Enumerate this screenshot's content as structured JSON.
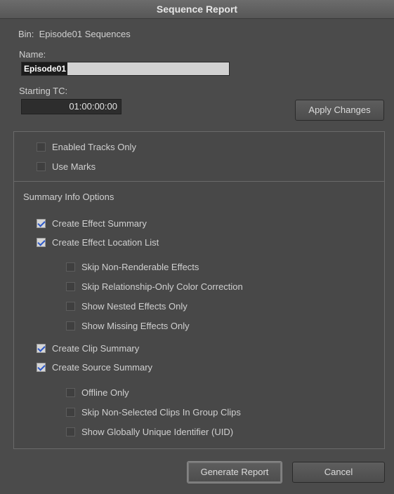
{
  "window": {
    "title": "Sequence Report"
  },
  "bin": {
    "label": "Bin:",
    "value": "Episode01 Sequences"
  },
  "name": {
    "label": "Name:",
    "value": "Episode01"
  },
  "starting_tc": {
    "label": "Starting TC:",
    "value": "01:00:00:00"
  },
  "buttons": {
    "apply": "Apply Changes",
    "generate": "Generate Report",
    "cancel": "Cancel"
  },
  "options": {
    "enabled_tracks_only": {
      "label": "Enabled Tracks Only",
      "checked": false
    },
    "use_marks": {
      "label": "Use Marks",
      "checked": false
    }
  },
  "summary": {
    "header": "Summary Info Options",
    "create_effect_summary": {
      "label": "Create Effect Summary",
      "checked": true
    },
    "create_effect_location_list": {
      "label": "Create Effect Location List",
      "checked": true
    },
    "skip_non_renderable": {
      "label": "Skip Non-Renderable Effects",
      "checked": false
    },
    "skip_relationship_only": {
      "label": "Skip Relationship-Only Color Correction",
      "checked": false
    },
    "show_nested_effects_only": {
      "label": "Show Nested Effects Only",
      "checked": false
    },
    "show_missing_effects_only": {
      "label": "Show Missing Effects Only",
      "checked": false
    },
    "create_clip_summary": {
      "label": "Create Clip Summary",
      "checked": true
    },
    "create_source_summary": {
      "label": "Create Source Summary",
      "checked": true
    },
    "offline_only": {
      "label": "Offline Only",
      "checked": false
    },
    "skip_non_selected_clips": {
      "label": "Skip Non-Selected Clips In Group Clips",
      "checked": false
    },
    "show_uid": {
      "label": "Show Globally Unique Identifier (UID)",
      "checked": false
    }
  }
}
